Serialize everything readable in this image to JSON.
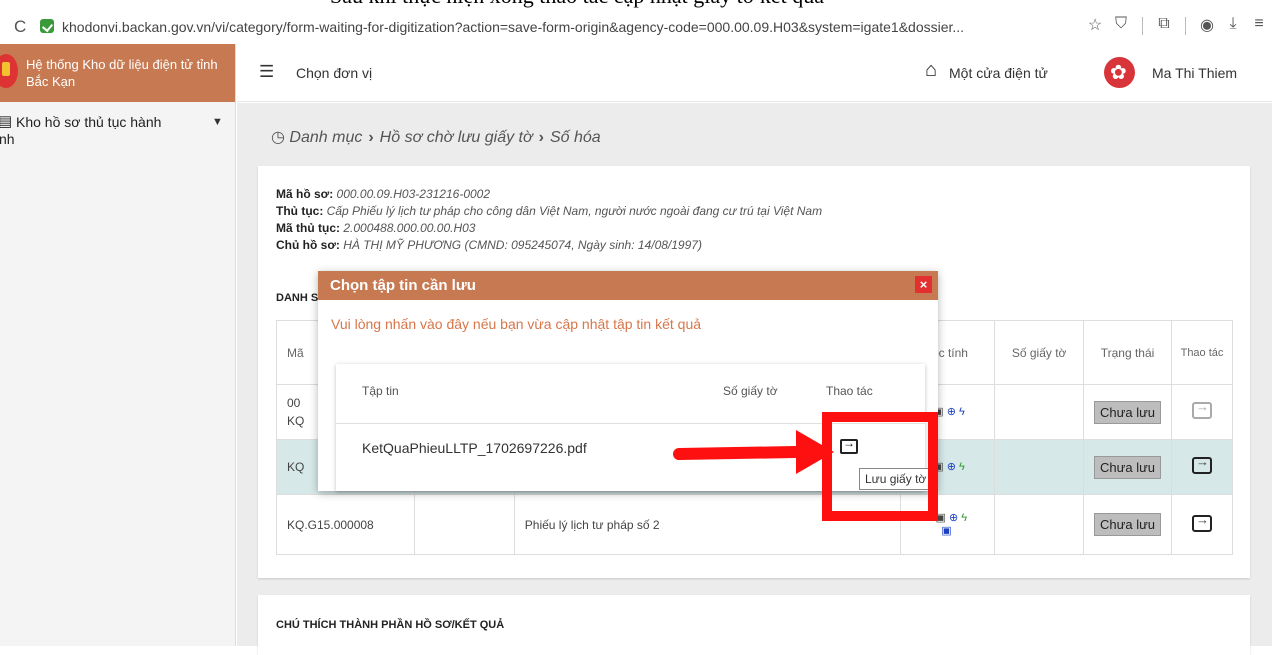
{
  "browser": {
    "url": "khodonvi.backan.gov.vn/vi/category/form-waiting-for-digitization?action=save-form-origin&agency-code=000.00.09.H03&system=igate1&dossier...",
    "icons": [
      "reload-icon",
      "star-icon",
      "shield-icon",
      "extension-icon",
      "profile-icon",
      "download-icon",
      "menu-icon"
    ]
  },
  "sidebar": {
    "title": "Hệ thống Kho dữ liệu điện tử tỉnh Bắc Kạn",
    "item_label": "Kho hồ sơ thủ tục hành",
    "item_label_cont": "nh"
  },
  "topbar": {
    "select_unit": "Chọn đơn vị",
    "one_stop": "Một cửa điện tử",
    "user": "Ma Thi Thiem"
  },
  "breadcrumb": {
    "items": [
      "Danh mục",
      "Hồ sơ chờ lưu giấy tờ",
      "Số hóa"
    ]
  },
  "dossier": {
    "code_label": "Mã hồ sơ:",
    "code": "000.00.09.H03-231216-0002",
    "proc_label": "Thủ tục:",
    "proc": "Cấp Phiếu lý lịch tư pháp cho công dân Việt Nam, người nước ngoài đang cư trú tại Việt Nam",
    "proc_code_label": "Mã thủ tục:",
    "proc_code": "2.000488.000.00.00.H03",
    "owner_label": "Chủ hồ sơ:",
    "owner": "HÀ THỊ MỸ PHƯƠNG (CMND:  095245074, Ngày sinh:  14/08/1997)"
  },
  "list": {
    "section_label": "DANH S",
    "headers": [
      "Mã",
      "",
      "",
      "uộc tính",
      "Số giấy tờ",
      "Trạng thái",
      "Thao tác"
    ],
    "rows": [
      {
        "code": "00",
        "code2": "KQ",
        "name": "",
        "status": "Chưa lưu"
      },
      {
        "code": "KQ",
        "code2": "",
        "name": "",
        "status": "Chưa lưu"
      },
      {
        "code": "KQ.G15.000008",
        "code2": "",
        "name": "Phiếu lý lịch tư pháp số 2",
        "status": "Chưa lưu"
      }
    ]
  },
  "legend": {
    "title": "CHÚ THÍCH THÀNH PHẦN HỒ SƠ/KẾT QUẢ"
  },
  "modal": {
    "title": "Chọn tập tin cần lưu",
    "close": "×",
    "refresh_link": "Vui lòng nhấn vào đây nếu bạn vừa cập nhật tập tin kết quả",
    "col_file": "Tập tin",
    "col_number": "Số giấy tờ",
    "col_action": "Thao tác",
    "file": "KetQuaPhieuLLTP_1702697226.pdf",
    "tooltip": "Lưu giấy tờ"
  },
  "colors": {
    "header": "#c77a52",
    "annotation": "#ff1010",
    "link": "#d8764a"
  }
}
